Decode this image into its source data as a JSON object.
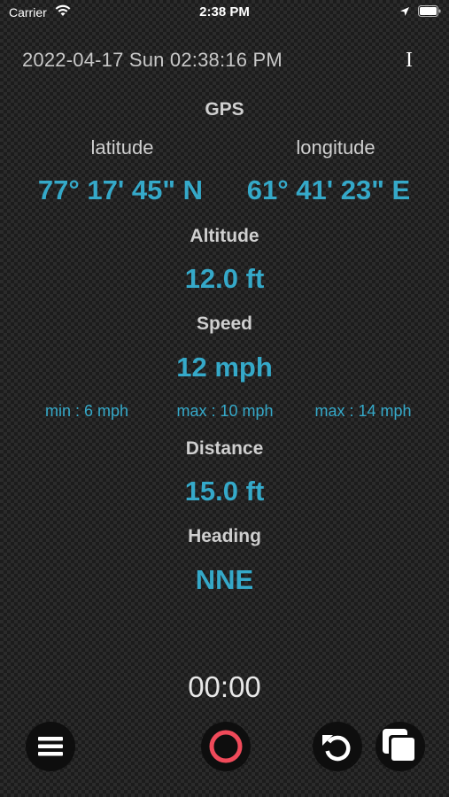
{
  "status_bar": {
    "carrier": "Carrier",
    "time": "2:38 PM"
  },
  "header": {
    "datetime": "2022-04-17 Sun 02:38:16 PM",
    "info_icon_glyph": "I"
  },
  "gps": {
    "title": "GPS",
    "latitude_label": "latitude",
    "longitude_label": "longitude",
    "latitude_value": "77° 17' 45\" N",
    "longitude_value": "61° 41' 23\" E"
  },
  "altitude": {
    "label": "Altitude",
    "value": "12.0 ft"
  },
  "speed": {
    "label": "Speed",
    "value": "12 mph",
    "stats": [
      "min : 6 mph",
      "max : 10 mph",
      "max : 14 mph"
    ]
  },
  "distance": {
    "label": "Distance",
    "value": "15.0 ft"
  },
  "heading": {
    "label": "Heading",
    "value": "NNE"
  },
  "timer": {
    "value": "00:00"
  },
  "toolbar": {
    "icons": [
      "menu-icon",
      "record-icon",
      "reset-icon",
      "copy-icon"
    ]
  },
  "colors": {
    "accent": "#35a9c9",
    "record": "#f04a5a",
    "label": "#cfcfcf"
  }
}
